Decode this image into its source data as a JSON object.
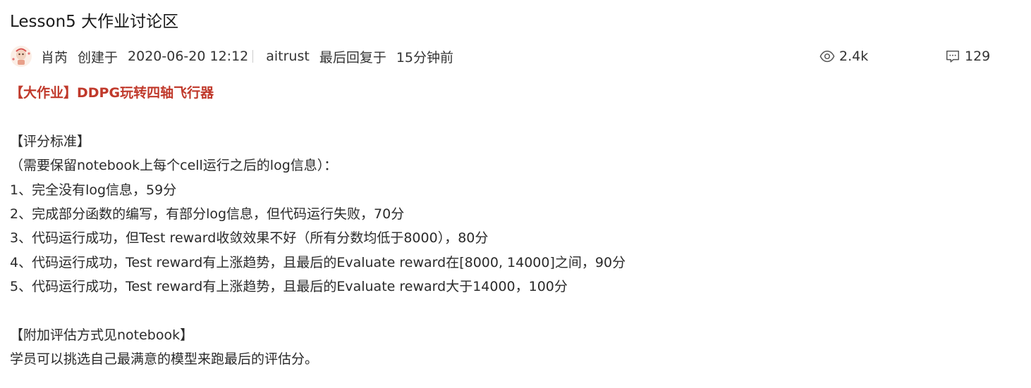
{
  "post": {
    "title": "Lesson5 大作业讨论区",
    "author": "肖芮",
    "created_label": "创建于",
    "created_time": "2020-06-20 12:12",
    "last_reply_user": "aitrust",
    "last_reply_label": "最后回复于",
    "last_reply_time": "15分钟前",
    "views": "2.4k",
    "replies": "129"
  },
  "content": {
    "headline": "【大作业】DDPG玩转四轴飞行器",
    "lines": [
      "【评分标准】",
      "（需要保留notebook上每个cell运行之后的log信息）：",
      "1、完全没有log信息，59分",
      "2、完成部分函数的编写，有部分log信息，但代码运行失败，70分",
      "3、代码运行成功，但Test reward收敛效果不好（所有分数均低于8000），80分",
      "4、代码运行成功，Test reward有上涨趋势，且最后的Evaluate reward在[8000, 14000]之间，90分",
      "5、代码运行成功，Test reward有上涨趋势，且最后的Evaluate reward大于14000，100分",
      "",
      "【附加评估方式见notebook】",
      "学员可以挑选自己最满意的模型来跑最后的评估分。"
    ]
  },
  "icons": {
    "views": "eye-icon",
    "replies": "comment-icon",
    "avatar": "avatar"
  },
  "colors": {
    "headline": "#c0392b",
    "text": "#2a2a2a",
    "meta": "#333333",
    "separator": "#cccccc"
  }
}
